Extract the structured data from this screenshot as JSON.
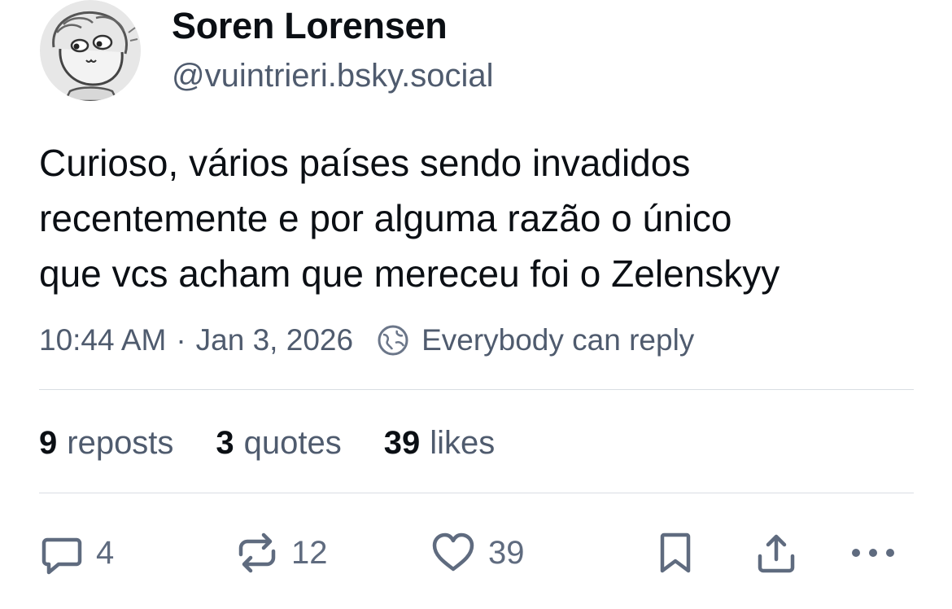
{
  "author": {
    "display_name": "Soren Lorensen",
    "handle": "@vuintrieri.bsky.social",
    "avatar_icon": "cartoon-face-avatar"
  },
  "post": {
    "text": "Curioso, vários países sendo invadidos\nrecentemente e por alguma razão o único\nque vcs acham que mereceu foi o Zelenskyy"
  },
  "meta": {
    "time": "10:44 AM",
    "separator": "·",
    "date": "Jan 3, 2026",
    "reply_setting": "Everybody can reply",
    "reply_icon": "globe-icon"
  },
  "stats": {
    "reposts_count": "9",
    "reposts_label": "reposts",
    "quotes_count": "3",
    "quotes_label": "quotes",
    "likes_count": "39",
    "likes_label": "likes"
  },
  "actions": {
    "reply_count": "4",
    "repost_count": "12",
    "like_count": "39",
    "icons": [
      "reply-icon",
      "repost-icon",
      "like-icon",
      "bookmark-icon",
      "share-icon",
      "more-icon"
    ]
  },
  "colors": {
    "text_primary": "#0b0f14",
    "text_secondary": "#4f5b6e",
    "icon": "#5f6b7f",
    "divider": "#d9dde3"
  }
}
